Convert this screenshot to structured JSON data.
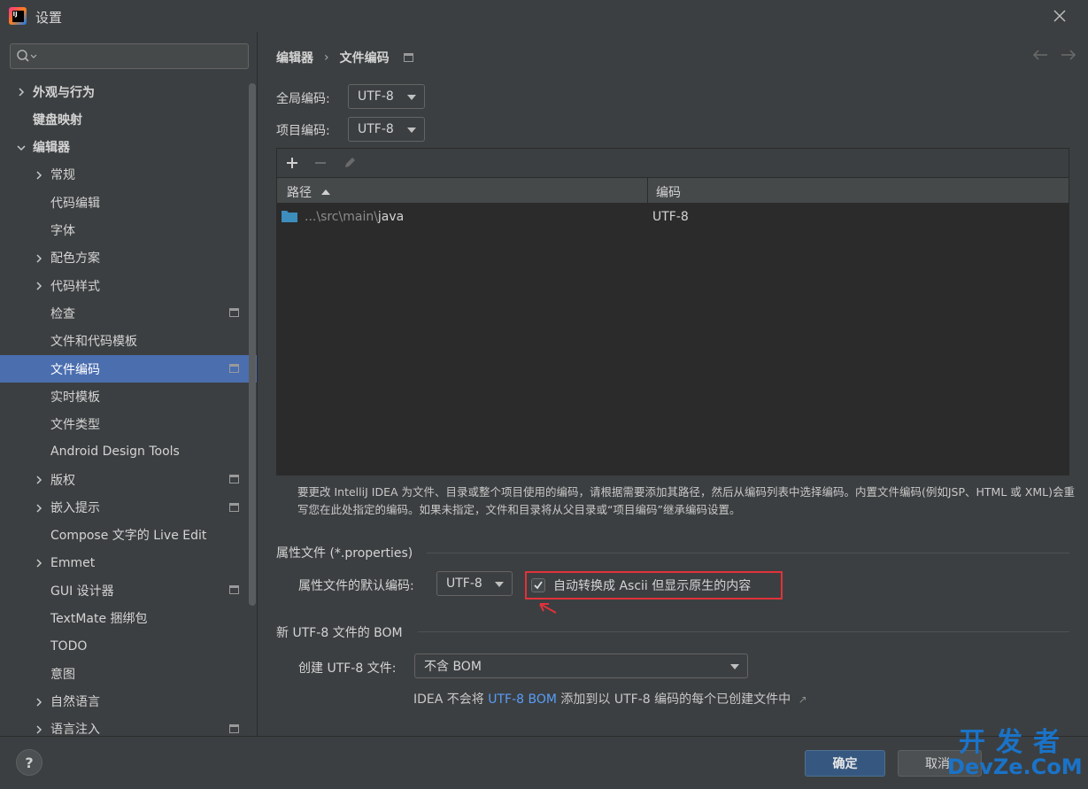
{
  "window": {
    "title": "设置",
    "app_icon_text": "IJ"
  },
  "sidebar": {
    "search_placeholder": "",
    "items": [
      {
        "label": "外观与行为",
        "expander": "collapsed",
        "level": 0
      },
      {
        "label": "键盘映射",
        "expander": "none",
        "level": 0
      },
      {
        "label": "编辑器",
        "expander": "expanded",
        "level": 0
      },
      {
        "label": "常规",
        "expander": "collapsed",
        "level": 1
      },
      {
        "label": "代码编辑",
        "expander": "none",
        "level": 1
      },
      {
        "label": "字体",
        "expander": "none",
        "level": 1
      },
      {
        "label": "配色方案",
        "expander": "collapsed",
        "level": 1
      },
      {
        "label": "代码样式",
        "expander": "collapsed",
        "level": 1
      },
      {
        "label": "检查",
        "expander": "none",
        "level": 1,
        "project_icon": true
      },
      {
        "label": "文件和代码模板",
        "expander": "none",
        "level": 1
      },
      {
        "label": "文件编码",
        "expander": "none",
        "level": 1,
        "project_icon": true,
        "selected": true
      },
      {
        "label": "实时模板",
        "expander": "none",
        "level": 1
      },
      {
        "label": "文件类型",
        "expander": "none",
        "level": 1
      },
      {
        "label": "Android Design Tools",
        "expander": "none",
        "level": 1
      },
      {
        "label": "版权",
        "expander": "collapsed",
        "level": 1,
        "project_icon": true
      },
      {
        "label": "嵌入提示",
        "expander": "collapsed",
        "level": 1,
        "project_icon": true
      },
      {
        "label": "Compose 文字的 Live Edit",
        "expander": "none",
        "level": 1
      },
      {
        "label": "Emmet",
        "expander": "collapsed",
        "level": 1
      },
      {
        "label": "GUI 设计器",
        "expander": "none",
        "level": 1,
        "project_icon": true
      },
      {
        "label": "TextMate 捆绑包",
        "expander": "none",
        "level": 1
      },
      {
        "label": "TODO",
        "expander": "none",
        "level": 1
      },
      {
        "label": "意图",
        "expander": "none",
        "level": 1
      },
      {
        "label": "自然语言",
        "expander": "collapsed",
        "level": 1
      },
      {
        "label": "语言注入",
        "expander": "collapsed",
        "level": 1,
        "project_icon": true
      }
    ]
  },
  "main": {
    "breadcrumb": {
      "parent": "编辑器",
      "separator": "›",
      "current": "文件编码"
    },
    "global_encoding": {
      "label": "全局编码:",
      "value": "UTF-8"
    },
    "project_encoding": {
      "label": "项目编码:",
      "value": "UTF-8"
    },
    "table": {
      "headers": {
        "path": "路径",
        "encoding": "编码"
      },
      "rows": [
        {
          "path_prefix": "...\\src\\main\\",
          "path_name": "java",
          "encoding": "UTF-8"
        }
      ]
    },
    "help_text": "要更改 IntelliJ IDEA 为文件、目录或整个项目使用的编码，请根据需要添加其路径，然后从编码列表中选择编码。内置文件编码(例如JSP、HTML 或 XML)会重写您在此处指定的编码。如果未指定，文件和目录将从父目录或“项目编码”继承编码设置。",
    "properties": {
      "section_title": "属性文件 (*.properties)",
      "default_label": "属性文件的默认编码:",
      "default_value": "UTF-8",
      "checkbox_label": "自动转换成 Ascii 但显示原生的内容",
      "checkbox_checked": true
    },
    "bom": {
      "section_title": "新 UTF-8 文件的 BOM",
      "create_label": "创建 UTF-8 文件:",
      "create_value": "不含 BOM",
      "note_prefix": "IDEA 不会将 ",
      "note_link": "UTF-8 BOM",
      "note_suffix": " 添加到以 UTF-8 编码的每个已创建文件中",
      "note_arrow": "↗"
    }
  },
  "footer": {
    "help_label": "?",
    "ok_label": "确定",
    "cancel_label": "取消"
  },
  "watermark": {
    "top": "开发者",
    "bottom": "DevZe.CoM"
  },
  "colors": {
    "background": "#3c3f41",
    "selection": "#4b6eaf",
    "link": "#589df6",
    "primary_button": "#365880",
    "highlight_border": "#e0323a"
  }
}
